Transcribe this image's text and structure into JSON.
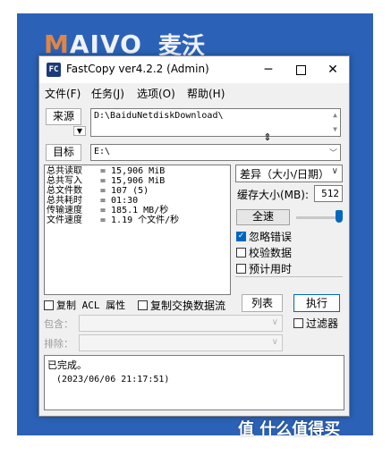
{
  "banner": {
    "logo": "AIVO",
    "logo_prefix": "M",
    "cn": "麦沃"
  },
  "window": {
    "title": "FastCopy ver4.2.2 (Admin)",
    "icon": "FC"
  },
  "menu": [
    "文件(F)",
    "任务(J)",
    "选项(O)",
    "帮助(H)"
  ],
  "source": {
    "button": "来源",
    "value": "D:\\BaiduNetdiskDownload\\"
  },
  "target": {
    "button": "目标",
    "value": "E:\\"
  },
  "stats": [
    {
      "label": "总共读取",
      "value": "= 15,906 MiB"
    },
    {
      "label": "总共写入",
      "value": "= 15,906 MiB"
    },
    {
      "label": "总文件数",
      "value": "= 107 (5)"
    },
    {
      "label": "总共耗时",
      "value": "= 01:30"
    },
    {
      "label": "传输速度",
      "value": "= 185.1 MB/秒"
    },
    {
      "label": "文件速度",
      "value": "= 1.19 个文件/秒"
    }
  ],
  "mode": {
    "selected": "差异（大小/日期）"
  },
  "buffer": {
    "label": "缓存大小(MB):",
    "value": "512"
  },
  "speed": {
    "label": "全速",
    "level": 1.0
  },
  "options": [
    {
      "label": "忽略错误",
      "checked": true
    },
    {
      "label": "校验数据",
      "checked": false
    },
    {
      "label": "预计用时",
      "checked": false
    }
  ],
  "bottom": {
    "acl": "复制 ACL 属性",
    "ads": "复制交换数据流",
    "list": "列表",
    "execute": "执行",
    "include": "包含：",
    "exclude": "排除：",
    "filter": "过滤器"
  },
  "status": {
    "line1": "已完成。",
    "line2": "(2023/06/06 21:17:51)"
  },
  "watermark": "值 什么值得买"
}
